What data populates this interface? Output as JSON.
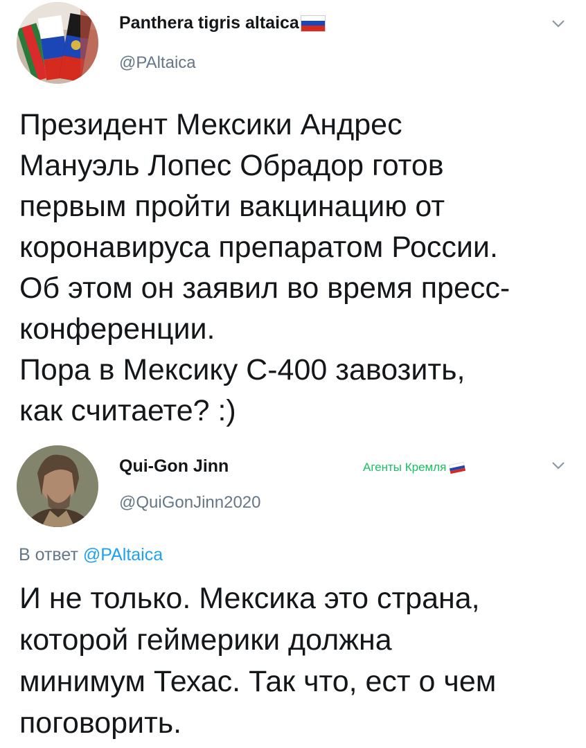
{
  "tweet1": {
    "display_name": "Panthera tigris altaica",
    "handle": "@PAltaica",
    "text": "Президент Мексики Андрес\nМануэль Лопес Обрадор готов\nпервым пройти вакцинацию от\nкоронавируса препаратом России.\nОб этом он заявил во время пресс-\nконференции.\nПора в Мексику С-400 завозить,\nкак считаете? :)",
    "flag_icon": "russian-flag-icon"
  },
  "tweet2": {
    "display_name": "Qui-Gon Jinn",
    "handle": "@QuiGonJinn2020",
    "badge": "Агенты Кремля",
    "reply_prefix": "В ответ",
    "reply_to": "@PAltaica",
    "text": "И не только. Мексика это страна,\nкоторой геймерики должна\nминимум Техас. Так что, ест о чем\nпоговорить."
  },
  "colors": {
    "text": "#14171a",
    "secondary": "#657786",
    "link": "#1da1f2",
    "badge": "#17bf63"
  }
}
